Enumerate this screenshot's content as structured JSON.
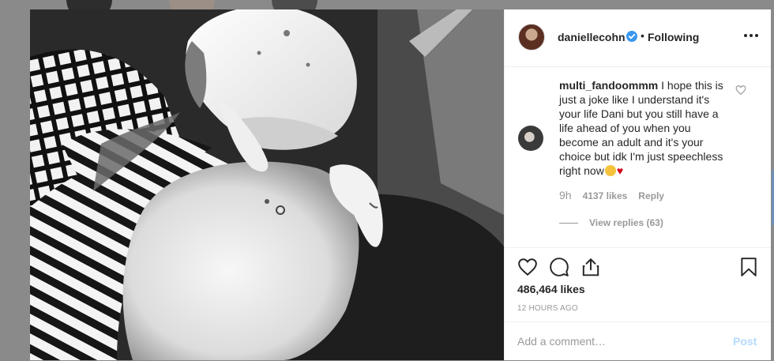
{
  "post": {
    "username": "daniellecohn",
    "dot": "•",
    "follow_status": "Following",
    "photo_alt": "Black and white photo of a pregnant belly",
    "likes": "486,464 likes",
    "timestamp": "12 HOURS AGO"
  },
  "comment": {
    "username": "multi_fandoommm",
    "text": "I hope this is just a joke like I understand it's your life Dani but you still have a life ahead of you when you become an adult and it's your choice but idk I'm just speechless right now",
    "time": "9h",
    "likes": "4137 likes",
    "reply_label": "Reply",
    "view_replies": "View replies (63)"
  },
  "add_comment": {
    "placeholder": "Add a comment…",
    "post_label": "Post"
  },
  "icons": {
    "verified": "verified-badge-icon",
    "more": "more-options-icon",
    "like": "heart-icon",
    "comment": "comment-icon",
    "share": "share-icon",
    "save": "bookmark-icon"
  },
  "colors": {
    "verified": "#3897f0",
    "post_disabled": "#b3dbff",
    "muted": "#999999",
    "text": "#262626"
  }
}
